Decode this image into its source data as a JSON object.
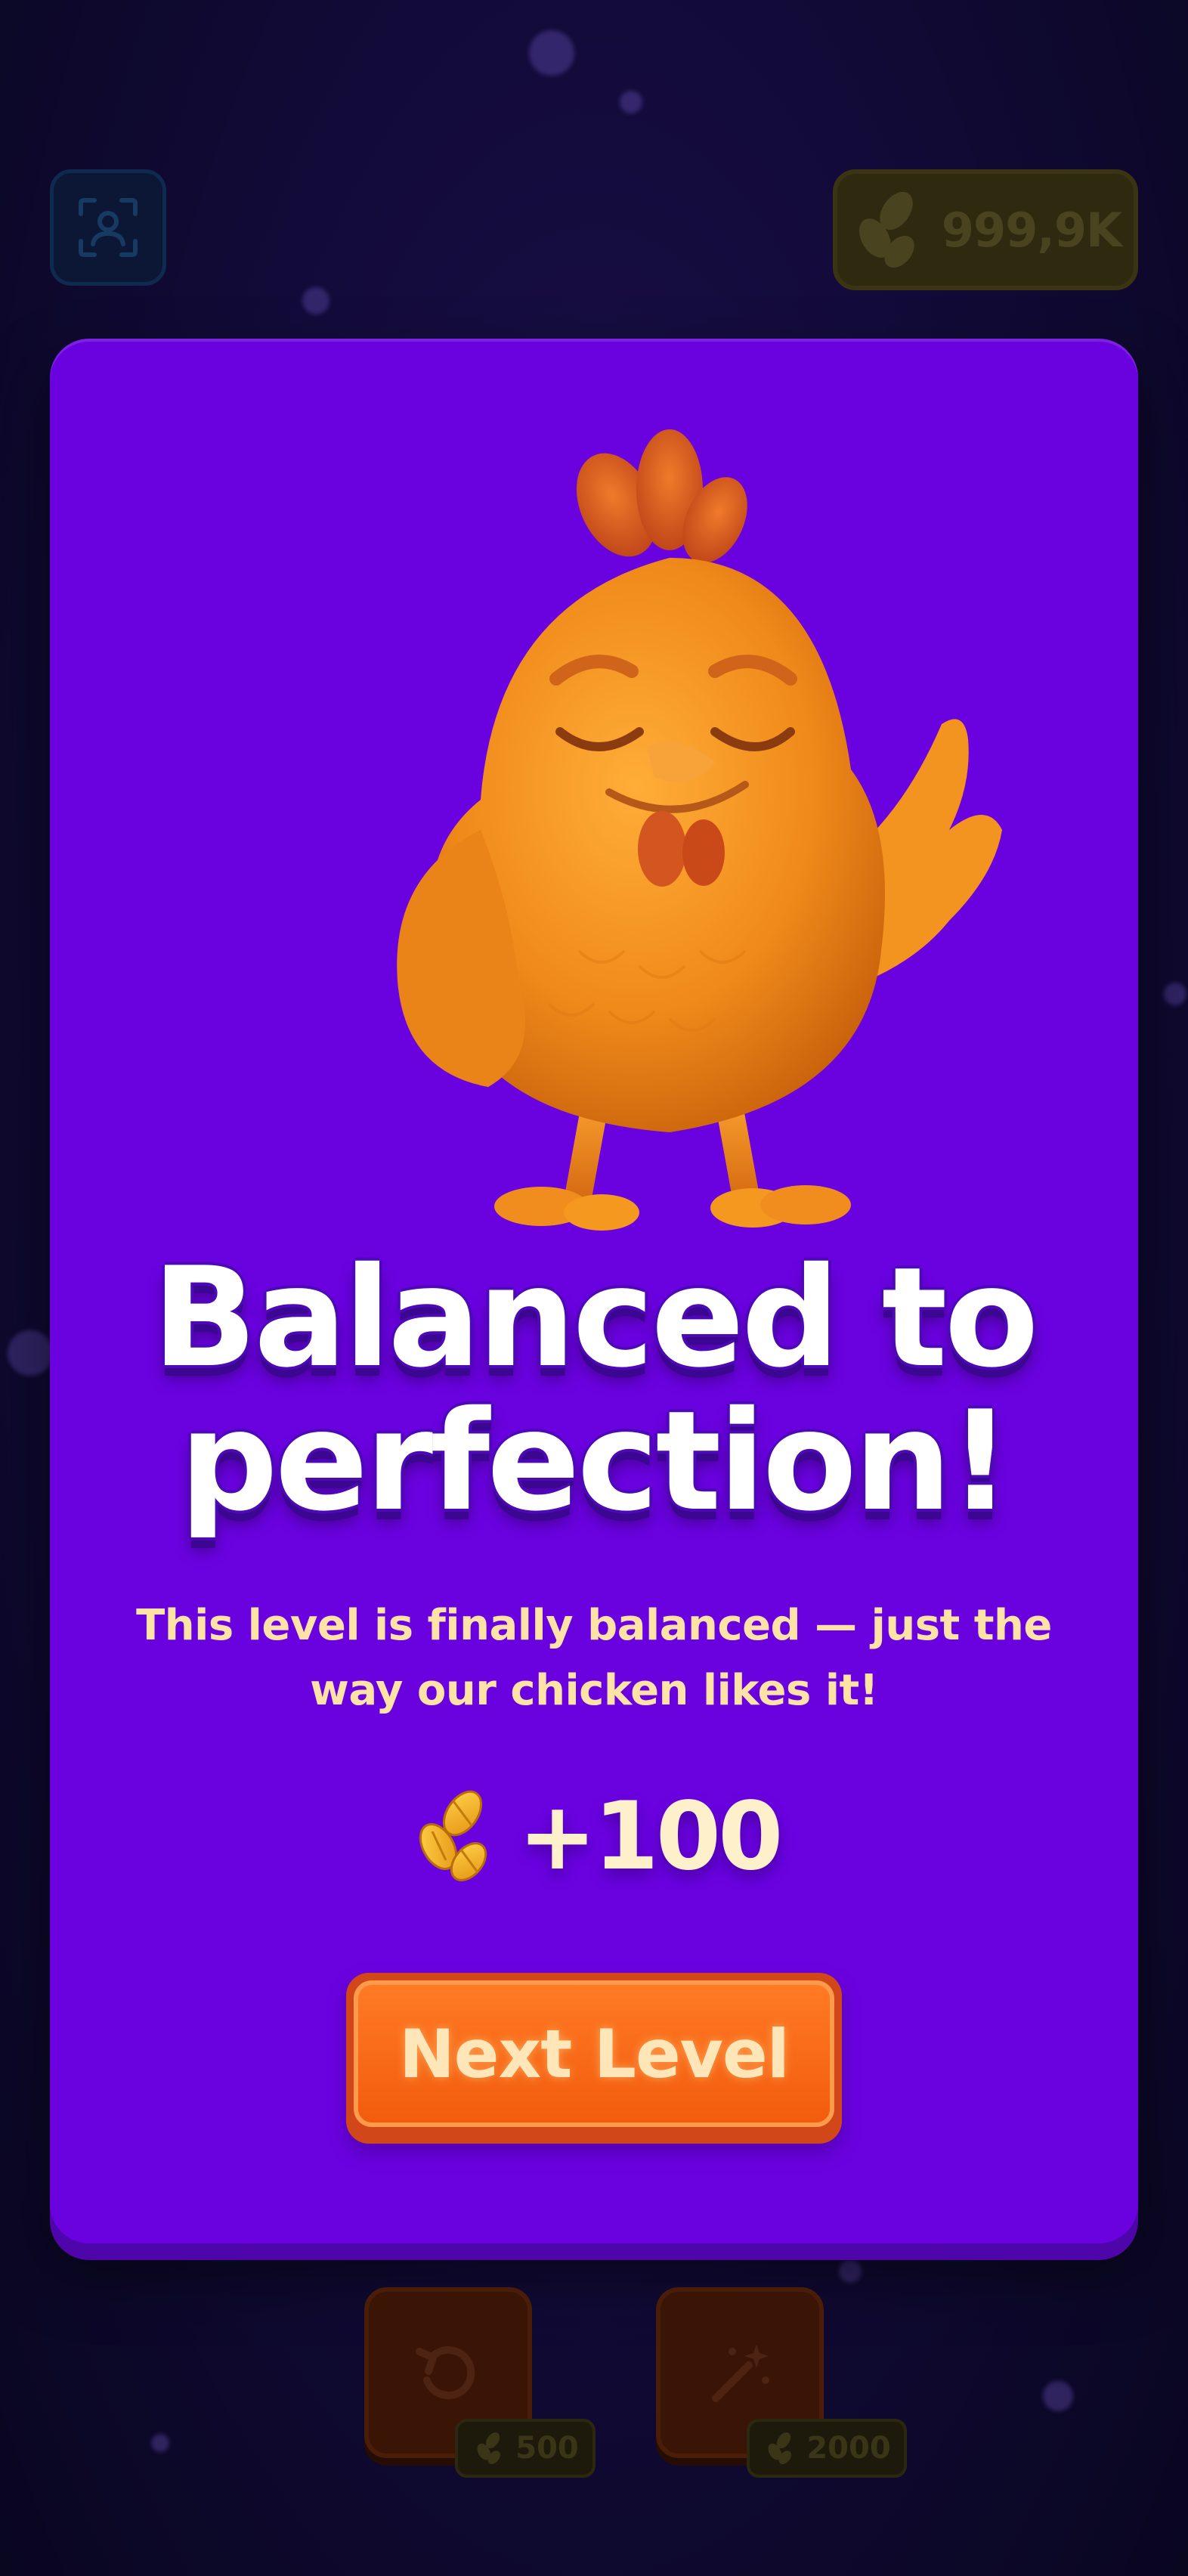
{
  "top_bar": {
    "profile_icon": "profile-scan-icon",
    "currency_icon": "seeds-icon",
    "currency_amount": "999,9K"
  },
  "modal": {
    "title_line1": "Balanced to",
    "title_line2": "perfection!",
    "subtitle_line1": "This level is finally balanced — just the",
    "subtitle_line2": "way our chicken likes it!",
    "reward_icon": "seeds-icon",
    "reward_amount": "+100",
    "next_button_label": "Next Level"
  },
  "tools": [
    {
      "icon": "undo-icon",
      "cost": "500"
    },
    {
      "icon": "magic-wand-icon",
      "cost": "2000"
    }
  ],
  "colors": {
    "modal_bg": "#6a02e0",
    "button_orange": "#f25c0d",
    "subtitle_text": "#ffe2a6",
    "background": "#110a36"
  }
}
